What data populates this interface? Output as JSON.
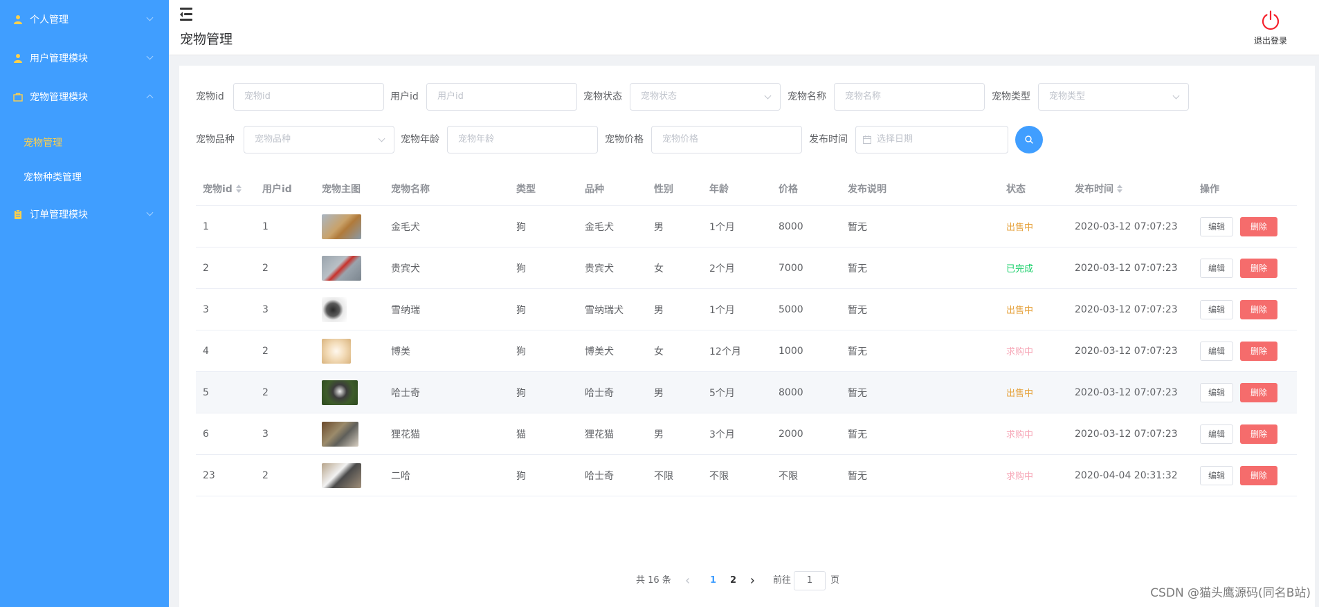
{
  "sidebar": {
    "items": [
      {
        "label": "个人管理"
      },
      {
        "label": "用户管理模块"
      },
      {
        "label": "宠物管理模块"
      },
      {
        "label": "订单管理模块"
      }
    ],
    "submenu": [
      {
        "label": "宠物管理",
        "active": true
      },
      {
        "label": "宠物种类管理",
        "active": false
      }
    ],
    "bg_color": "#409eff",
    "active_color": "#ffd04b"
  },
  "header": {
    "title": "宠物管理",
    "logout_label": "退出登录"
  },
  "filters": {
    "pet_id": {
      "label": "宠物id",
      "placeholder": "宠物id"
    },
    "user_id": {
      "label": "用户id",
      "placeholder": "用户id"
    },
    "status": {
      "label": "宠物状态",
      "placeholder": "宠物状态"
    },
    "name": {
      "label": "宠物名称",
      "placeholder": "宠物名称"
    },
    "type": {
      "label": "宠物类型",
      "placeholder": "宠物类型"
    },
    "breed": {
      "label": "宠物品种",
      "placeholder": "宠物品种"
    },
    "age": {
      "label": "宠物年龄",
      "placeholder": "宠物年龄"
    },
    "price": {
      "label": "宠物价格",
      "placeholder": "宠物价格"
    },
    "date": {
      "label": "发布时间",
      "placeholder": "选择日期"
    }
  },
  "table": {
    "columns": [
      "宠物id",
      "用户id",
      "宠物主图",
      "宠物名称",
      "类型",
      "品种",
      "性别",
      "年龄",
      "价格",
      "发布说明",
      "状态",
      "发布时间",
      "操作"
    ],
    "edit_label": "编辑",
    "delete_label": "删除",
    "rows": [
      {
        "id": "1",
        "uid": "1",
        "name": "金毛犬",
        "type": "狗",
        "breed": "金毛犬",
        "sex": "男",
        "age": "1个月",
        "price": "8000",
        "desc": "暂无",
        "status": "出售中",
        "status_color": "#e6a23c",
        "time": "2020-03-12 07:07:23"
      },
      {
        "id": "2",
        "uid": "2",
        "name": "贵宾犬",
        "type": "狗",
        "breed": "贵宾犬",
        "sex": "女",
        "age": "2个月",
        "price": "7000",
        "desc": "暂无",
        "status": "已完成",
        "status_color": "#13ce66",
        "time": "2020-03-12 07:07:23"
      },
      {
        "id": "3",
        "uid": "3",
        "name": "雪纳瑞",
        "type": "狗",
        "breed": "雪纳瑞犬",
        "sex": "男",
        "age": "1个月",
        "price": "5000",
        "desc": "暂无",
        "status": "出售中",
        "status_color": "#e6a23c",
        "time": "2020-03-12 07:07:23"
      },
      {
        "id": "4",
        "uid": "2",
        "name": "博美",
        "type": "狗",
        "breed": "博美犬",
        "sex": "女",
        "age": "12个月",
        "price": "1000",
        "desc": "暂无",
        "status": "求购中",
        "status_color": "#f7a8b8",
        "time": "2020-03-12 07:07:23"
      },
      {
        "id": "5",
        "uid": "2",
        "name": "哈士奇",
        "type": "狗",
        "breed": "哈士奇",
        "sex": "男",
        "age": "5个月",
        "price": "8000",
        "desc": "暂无",
        "status": "出售中",
        "status_color": "#e6a23c",
        "time": "2020-03-12 07:07:23"
      },
      {
        "id": "6",
        "uid": "3",
        "name": "狸花猫",
        "type": "猫",
        "breed": "狸花猫",
        "sex": "男",
        "age": "3个月",
        "price": "2000",
        "desc": "暂无",
        "status": "求购中",
        "status_color": "#f7a8b8",
        "time": "2020-03-12 07:07:23"
      },
      {
        "id": "23",
        "uid": "2",
        "name": "二哈",
        "type": "狗",
        "breed": "哈士奇",
        "sex": "不限",
        "age": "不限",
        "price": "不限",
        "desc": "暂无",
        "status": "求购中",
        "status_color": "#f7a8b8",
        "time": "2020-04-04 20:31:32"
      }
    ]
  },
  "pagination": {
    "total": "共 16 条",
    "pages": [
      "1",
      "2"
    ],
    "goto_prefix": "前往",
    "goto_value": "1",
    "goto_suffix": "页"
  },
  "watermark": "CSDN @猫头鹰源码(同名B站)"
}
